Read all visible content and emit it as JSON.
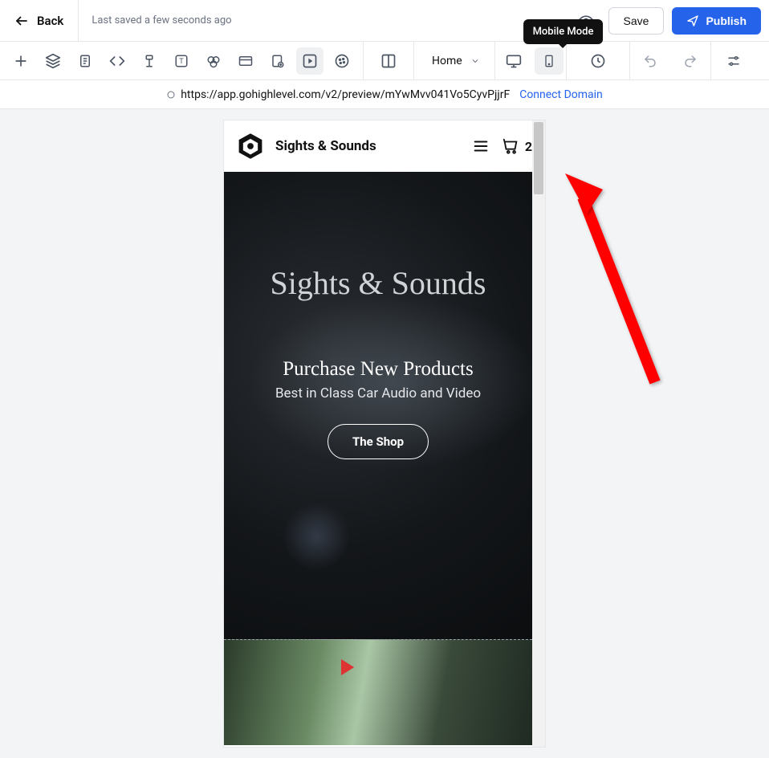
{
  "header": {
    "back_label": "Back",
    "saved_text": "Last saved a few seconds ago",
    "tooltip": "Mobile Mode",
    "save_label": "Save",
    "publish_label": "Publish"
  },
  "toolbar": {
    "page_name": "Home"
  },
  "urlbar": {
    "url": "https://app.gohighlevel.com/v2/preview/mYwMvv041Vo5CyvPjjrF",
    "connect_label": "Connect Domain"
  },
  "site": {
    "brand": "Sights & Sounds",
    "cart_count": "2",
    "hero_title": "Sights & Sounds",
    "hero_sub": "Purchase New Products",
    "hero_tag": "Best in Class Car Audio and Video",
    "shop_label": "The Shop"
  }
}
